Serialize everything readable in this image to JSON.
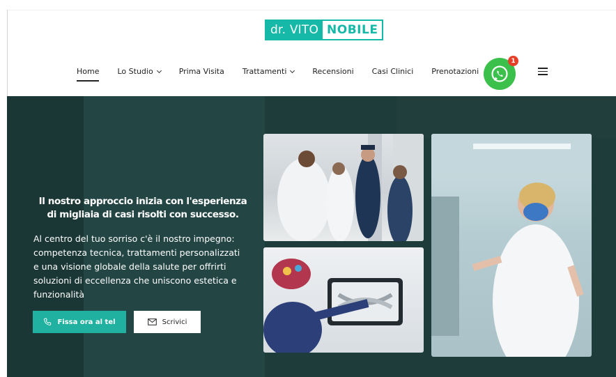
{
  "logo": {
    "first": "dr. VITO",
    "second": "NOBILE"
  },
  "nav": {
    "items": [
      {
        "label": "Home",
        "active": true,
        "dropdown": false
      },
      {
        "label": "Lo Studio",
        "active": false,
        "dropdown": true
      },
      {
        "label": "Prima Visita",
        "active": false,
        "dropdown": false
      },
      {
        "label": "Trattamenti",
        "active": false,
        "dropdown": true
      },
      {
        "label": "Recensioni",
        "active": false,
        "dropdown": false
      },
      {
        "label": "Casi Clinici",
        "active": false,
        "dropdown": false
      },
      {
        "label": "Prenotazioni",
        "active": false,
        "dropdown": false
      }
    ],
    "whatsapp_icon": "whatsapp-icon",
    "whatsapp_badge": "1",
    "menu_icon": "hamburger-menu-icon"
  },
  "hero": {
    "headline": "Il nostro approccio inizia con l'esperienza di migliaia di casi risolti con successo.",
    "paragraph": "Al centro del tuo sorriso c'è il nostro impegno: competenza tecnica, trattamenti personalizzati e una visione globale della salute per offrirti soluzioni di eccellenza che uniscono estetica e funzionalità",
    "button_call": "Fissa ora al tel",
    "button_write": "Scrivici",
    "call_icon": "phone-icon",
    "write_icon": "mail-icon"
  },
  "colors": {
    "accent": "#16b8a8",
    "hero_bg": "#1d3c3a",
    "whatsapp": "#3cc04c",
    "badge": "#e64128"
  }
}
